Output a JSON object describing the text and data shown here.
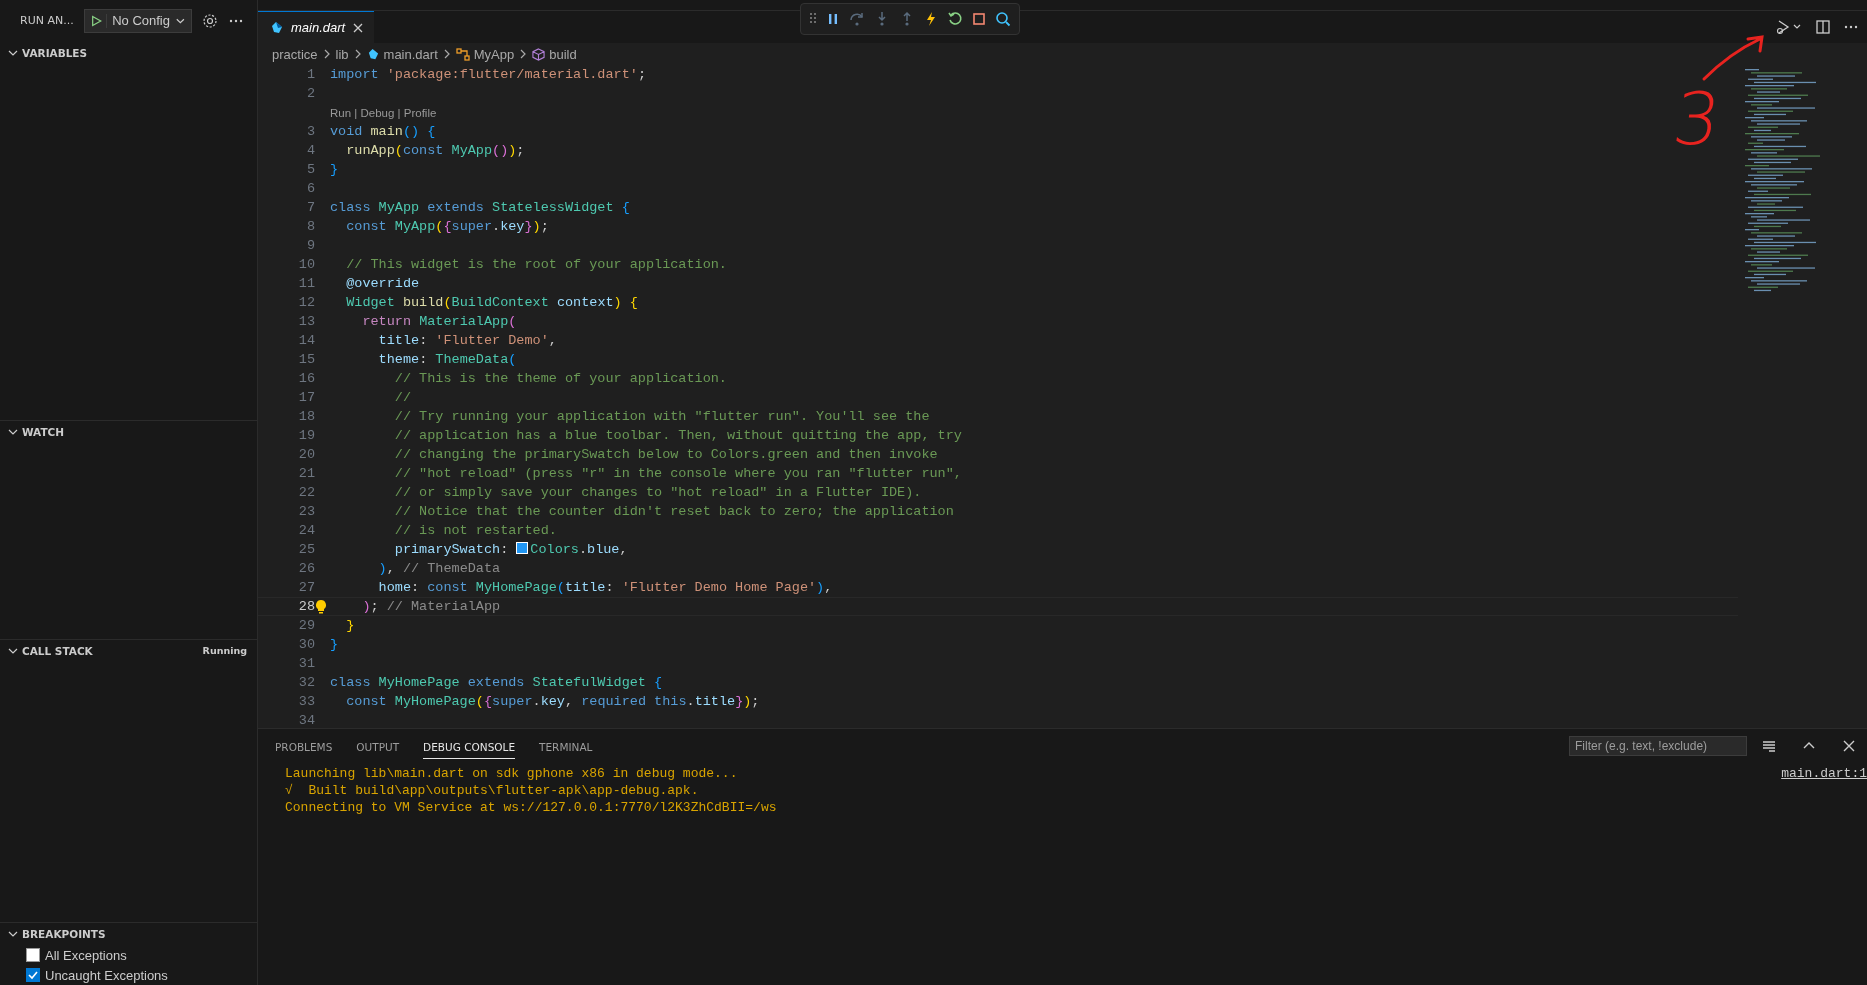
{
  "sidebar": {
    "title": "RUN AN...",
    "config": "No Config",
    "sections": [
      {
        "title": "VARIABLES",
        "expanded": true
      },
      {
        "title": "WATCH",
        "expanded": true
      },
      {
        "title": "CALL STACK",
        "expanded": true,
        "status": "Running"
      },
      {
        "title": "BREAKPOINTS",
        "expanded": true,
        "items": [
          {
            "label": "All Exceptions",
            "checked": false
          },
          {
            "label": "Uncaught Exceptions",
            "checked": true
          }
        ]
      }
    ]
  },
  "editor": {
    "tabs": [
      {
        "label": "main.dart",
        "selected": true
      }
    ],
    "breadcrumbs": [
      {
        "label": "practice",
        "kind": "folder"
      },
      {
        "label": "lib",
        "kind": "folder"
      },
      {
        "label": "main.dart",
        "kind": "file"
      },
      {
        "label": "MyApp",
        "kind": "class"
      },
      {
        "label": "build",
        "kind": "method"
      }
    ],
    "codelens": "Run | Debug | Profile",
    "lines": [
      {
        "number": "1",
        "current": false,
        "tokens": [
          {
            "t": "import ",
            "kind": "kw"
          },
          {
            "t": "'package:flutter/material.dart'",
            "kind": "str"
          },
          {
            "t": ";",
            "kind": "p"
          }
        ]
      },
      {
        "number": "2",
        "current": false
      },
      {
        "number": "3",
        "current": false,
        "codelens": true,
        "tokens": [
          {
            "t": "void ",
            "kind": "kw"
          },
          {
            "t": "main",
            "kind": "fn"
          },
          {
            "t": "() {",
            "kind": "b3"
          }
        ]
      },
      {
        "number": "4",
        "current": false,
        "tokens": [
          {
            "t": "  runApp",
            "kind": "fn"
          },
          {
            "t": "(",
            "kind": "b1"
          },
          {
            "t": "const ",
            "kind": "kw"
          },
          {
            "t": "MyApp",
            "kind": "type"
          },
          {
            "t": "()",
            "kind": "b2"
          },
          {
            "t": ")",
            "kind": "b1"
          },
          {
            "t": ";",
            "kind": "p"
          }
        ]
      },
      {
        "number": "5",
        "current": false,
        "tokens": [
          {
            "t": "}",
            "kind": "b3"
          }
        ]
      },
      {
        "number": "6",
        "current": false
      },
      {
        "number": "7",
        "current": false,
        "tokens": [
          {
            "t": "class ",
            "kind": "kw"
          },
          {
            "t": "MyApp ",
            "kind": "type"
          },
          {
            "t": "extends ",
            "kind": "kw"
          },
          {
            "t": "StatelessWidget ",
            "kind": "type"
          },
          {
            "t": "{",
            "kind": "b3"
          }
        ]
      },
      {
        "number": "8",
        "current": false,
        "tokens": [
          {
            "t": "  const ",
            "kind": "kw"
          },
          {
            "t": "MyApp",
            "kind": "type"
          },
          {
            "t": "(",
            "kind": "b1"
          },
          {
            "t": "{",
            "kind": "b2"
          },
          {
            "t": "super",
            "kind": "kw"
          },
          {
            "t": ".",
            "kind": "p"
          },
          {
            "t": "key",
            "kind": "var"
          },
          {
            "t": "}",
            "kind": "b2"
          },
          {
            "t": ")",
            "kind": "b1"
          },
          {
            "t": ";",
            "kind": "p"
          }
        ]
      },
      {
        "number": "9",
        "current": false
      },
      {
        "number": "10",
        "current": false,
        "tokens": [
          {
            "t": "  // This widget is the root of your application.",
            "kind": "cm"
          }
        ]
      },
      {
        "number": "11",
        "current": false,
        "tokens": [
          {
            "t": "  @override",
            "kind": "var"
          }
        ]
      },
      {
        "number": "12",
        "current": false,
        "tokens": [
          {
            "t": "  Widget ",
            "kind": "type"
          },
          {
            "t": "build",
            "kind": "fn"
          },
          {
            "t": "(",
            "kind": "b1"
          },
          {
            "t": "BuildContext ",
            "kind": "type"
          },
          {
            "t": "context",
            "kind": "var"
          },
          {
            "t": ") {",
            "kind": "b1"
          }
        ]
      },
      {
        "number": "13",
        "current": false,
        "tokens": [
          {
            "t": "    return ",
            "kind": "ctrl"
          },
          {
            "t": "MaterialApp",
            "kind": "type"
          },
          {
            "t": "(",
            "kind": "b2"
          }
        ]
      },
      {
        "number": "14",
        "current": false,
        "tokens": [
          {
            "t": "      title",
            "kind": "var"
          },
          {
            "t": ": ",
            "kind": "p"
          },
          {
            "t": "'Flutter Demo'",
            "kind": "str"
          },
          {
            "t": ",",
            "kind": "p"
          }
        ]
      },
      {
        "number": "15",
        "current": false,
        "tokens": [
          {
            "t": "      theme",
            "kind": "var"
          },
          {
            "t": ": ",
            "kind": "p"
          },
          {
            "t": "ThemeData",
            "kind": "type"
          },
          {
            "t": "(",
            "kind": "b3"
          }
        ]
      },
      {
        "number": "16",
        "current": false,
        "tokens": [
          {
            "t": "        // This is the theme of your application.",
            "kind": "cm"
          }
        ]
      },
      {
        "number": "17",
        "current": false,
        "tokens": [
          {
            "t": "        //",
            "kind": "cm"
          }
        ]
      },
      {
        "number": "18",
        "current": false,
        "tokens": [
          {
            "t": "        // Try running your application with \"flutter run\". You'll see the",
            "kind": "cm"
          }
        ]
      },
      {
        "number": "19",
        "current": false,
        "tokens": [
          {
            "t": "        // application has a blue toolbar. Then, without quitting the app, try",
            "kind": "cm"
          }
        ]
      },
      {
        "number": "20",
        "current": false,
        "tokens": [
          {
            "t": "        // changing the primarySwatch below to Colors.green and then invoke",
            "kind": "cm"
          }
        ]
      },
      {
        "number": "21",
        "current": false,
        "tokens": [
          {
            "t": "        // \"hot reload\" (press \"r\" in the console where you ran \"flutter run\",",
            "kind": "cm"
          }
        ]
      },
      {
        "number": "22",
        "current": false,
        "tokens": [
          {
            "t": "        // or simply save your changes to \"hot reload\" in a Flutter IDE).",
            "kind": "cm"
          }
        ]
      },
      {
        "number": "23",
        "current": false,
        "tokens": [
          {
            "t": "        // Notice that the counter didn't reset back to zero; the application",
            "kind": "cm"
          }
        ]
      },
      {
        "number": "24",
        "current": false,
        "tokens": [
          {
            "t": "        // is not restarted.",
            "kind": "cm"
          }
        ]
      },
      {
        "number": "25",
        "current": false,
        "tokens": [
          {
            "t": "        primarySwatch",
            "kind": "var"
          },
          {
            "t": ": ",
            "kind": "p"
          },
          {
            "kind": "swatch",
            "color": "#2196f3"
          },
          {
            "t": "Colors",
            "kind": "type"
          },
          {
            "t": ".",
            "kind": "p"
          },
          {
            "t": "blue",
            "kind": "var"
          },
          {
            "t": ",",
            "kind": "p"
          }
        ]
      },
      {
        "number": "26",
        "current": false,
        "tokens": [
          {
            "t": "      )",
            "kind": "b3"
          },
          {
            "t": ", ",
            "kind": "p"
          },
          {
            "t": "// ThemeData",
            "kind": "hint"
          }
        ]
      },
      {
        "number": "27",
        "current": false,
        "tokens": [
          {
            "t": "      home",
            "kind": "var"
          },
          {
            "t": ": ",
            "kind": "p"
          },
          {
            "t": "const ",
            "kind": "kw"
          },
          {
            "t": "MyHomePage",
            "kind": "type"
          },
          {
            "t": "(",
            "kind": "b3"
          },
          {
            "t": "title",
            "kind": "var"
          },
          {
            "t": ": ",
            "kind": "p"
          },
          {
            "t": "'Flutter Demo Home Page'",
            "kind": "str"
          },
          {
            "t": ")",
            "kind": "b3"
          },
          {
            "t": ",",
            "kind": "p"
          }
        ]
      },
      {
        "number": "28",
        "current": true,
        "tokens": [
          {
            "t": "    )",
            "kind": "b2"
          },
          {
            "t": "; ",
            "kind": "p"
          },
          {
            "t": "// MaterialApp",
            "kind": "hint"
          }
        ]
      },
      {
        "number": "29",
        "current": false,
        "tokens": [
          {
            "t": "  }",
            "kind": "b1"
          }
        ]
      },
      {
        "number": "30",
        "current": false,
        "tokens": [
          {
            "t": "}",
            "kind": "b3"
          }
        ]
      },
      {
        "number": "31",
        "current": false
      },
      {
        "number": "32",
        "current": false,
        "tokens": [
          {
            "t": "class ",
            "kind": "kw"
          },
          {
            "t": "MyHomePage ",
            "kind": "type"
          },
          {
            "t": "extends ",
            "kind": "kw"
          },
          {
            "t": "StatefulWidget ",
            "kind": "type"
          },
          {
            "t": "{",
            "kind": "b3"
          }
        ]
      },
      {
        "number": "33",
        "current": false,
        "tokens": [
          {
            "t": "  const ",
            "kind": "kw"
          },
          {
            "t": "MyHomePage",
            "kind": "type"
          },
          {
            "t": "(",
            "kind": "b1"
          },
          {
            "t": "{",
            "kind": "b2"
          },
          {
            "t": "super",
            "kind": "kw"
          },
          {
            "t": ".",
            "kind": "p"
          },
          {
            "t": "key",
            "kind": "var"
          },
          {
            "t": ", ",
            "kind": "p"
          },
          {
            "t": "required ",
            "kind": "kw"
          },
          {
            "t": "this",
            "kind": "kw"
          },
          {
            "t": ".",
            "kind": "p"
          },
          {
            "t": "title",
            "kind": "var"
          },
          {
            "t": "}",
            "kind": "b2"
          },
          {
            "t": ")",
            "kind": "b1"
          },
          {
            "t": ";",
            "kind": "p"
          }
        ]
      },
      {
        "number": "34",
        "current": false
      }
    ]
  },
  "annotation": {
    "label": "3"
  },
  "panel": {
    "tabs": [
      {
        "label": "PROBLEMS",
        "selected": false
      },
      {
        "label": "OUTPUT",
        "selected": false
      },
      {
        "label": "DEBUG CONSOLE",
        "selected": true
      },
      {
        "label": "TERMINAL",
        "selected": false
      }
    ],
    "filter": {
      "placeholder": "Filter (e.g. text, !exclude)"
    },
    "console": [
      {
        "text": "Launching lib\\main.dart on sdk gphone x86 in debug mode..."
      },
      {
        "text": "√  Built build\\app\\outputs\\flutter-apk\\app-debug.apk."
      },
      {
        "text": "Connecting to VM Service at ws://127.0.0.1:7770/l2K3ZhCdBII=/ws"
      }
    ],
    "source_link": "main.dart:1"
  }
}
